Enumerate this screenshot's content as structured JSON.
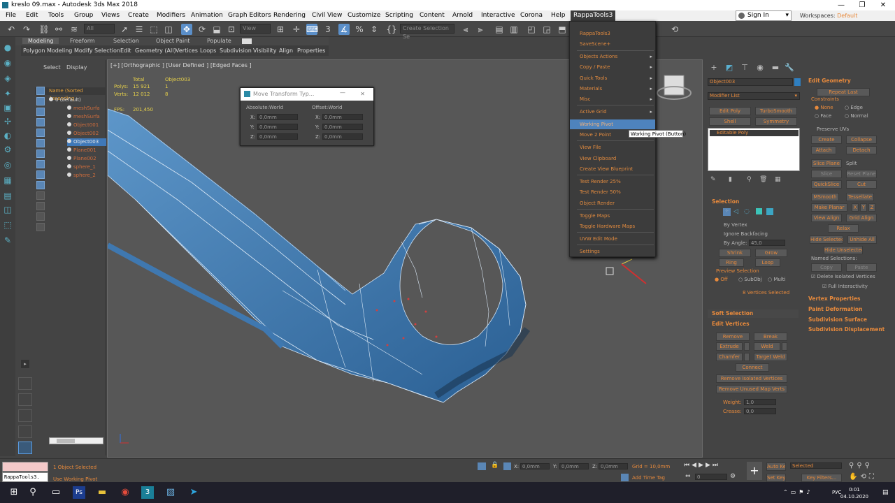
{
  "window": {
    "title": "kreslo 09.max - Autodesk 3ds Max 2018",
    "min": "—",
    "max": "❐",
    "close": "✕"
  },
  "menu": [
    "File",
    "Edit",
    "Tools",
    "Group",
    "Views",
    "Create",
    "Modifiers",
    "Animation",
    "Graph Editors",
    "Rendering",
    "Civil View",
    "Customize",
    "Scripting",
    "Content",
    "Arnold",
    "Interactive",
    "Corona",
    "Help",
    "RappaTools3"
  ],
  "signin": "Sign In",
  "workspaces": {
    "label": "Workspaces:",
    "value": "Default"
  },
  "toolbar": {
    "filter": "All",
    "view": "View",
    "selection_set": "Create Selection Se"
  },
  "ribbon": {
    "tabs": [
      "Modeling",
      "Freeform",
      "Selection",
      "Object Paint",
      "Populate"
    ],
    "sub": [
      "Polygon Modeling",
      "Modify Selection",
      "Edit",
      "Geometry (All)",
      "Vertices",
      "Loops",
      "Subdivision",
      "Visibility",
      "Align",
      "Properties"
    ]
  },
  "scene_explorer": {
    "tabs": [
      "Select",
      "Display"
    ],
    "column": "Name (Sorted Ascending",
    "objects": [
      "0 (default)",
      "meshSurfa",
      "meshSurfa",
      "Object001",
      "Object002",
      "Object003",
      "Plane001",
      "Plane002",
      "sphere_1",
      "sphere_2"
    ],
    "selected_index": 5
  },
  "viewport": {
    "label": "[+] [Orthographic ] [User Defined ] [Edged Faces ]",
    "stats": {
      "col1": "Total",
      "col2": "Object003",
      "polys_label": "Polys:",
      "polys_total": "15 921",
      "polys_obj": "1",
      "verts_label": "Verts:",
      "verts_total": "12 012",
      "verts_obj": "8",
      "fps_label": "FPS:",
      "fps": "201,450"
    }
  },
  "move_transform": {
    "title": "Move Transform Typ...",
    "abs": "Absolute:World",
    "off": "Offset:World",
    "x": "X:",
    "y": "Y:",
    "z": "Z:",
    "abs_x": "0,0mm",
    "abs_y": "0,0mm",
    "abs_z": "0,0mm",
    "off_x": "0,0mm",
    "off_y": "0,0mm",
    "off_z": "0,0mm"
  },
  "rappa_menu": {
    "items": [
      {
        "label": "RappaTools3"
      },
      {
        "label": "SaveScene+"
      },
      {
        "label": "Objects Actions",
        "sub": true
      },
      {
        "label": "Copy / Paste",
        "sub": true
      },
      {
        "label": "Quick Tools",
        "sub": true
      },
      {
        "label": "Materials",
        "sub": true
      },
      {
        "label": "Misc",
        "sub": true
      },
      {
        "label": "Active Grid",
        "sub": true
      },
      {
        "label": "Working Pivot"
      },
      {
        "label": "Move 2 Point"
      },
      {
        "label": "View File"
      },
      {
        "label": "View Clipboard"
      },
      {
        "label": "Create View Blueprint"
      },
      {
        "label": "Test Render 25%"
      },
      {
        "label": "Test Render 50%"
      },
      {
        "label": "Object Render"
      },
      {
        "label": "Toggle Maps"
      },
      {
        "label": "Toggle Hardware Maps"
      },
      {
        "label": "UVW Edit Mode"
      },
      {
        "label": "Settings"
      }
    ],
    "highlighted": "Working Pivot"
  },
  "tooltip": "Working Pivot (Button)",
  "command_panel": {
    "object_name": "Object003",
    "modifier_list": "Modifier List",
    "quick_buttons": [
      "Edit Poly",
      "TurboSmooth",
      "Shell",
      "Symmetry"
    ],
    "stack_item": "Editable Poly",
    "selection": {
      "title": "Selection",
      "by_vertex": "By Vertex",
      "ignore_backfacing": "Ignore Backfacing",
      "by_angle": "By Angle:",
      "angle": "45,0",
      "shrink": "Shrink",
      "grow": "Grow",
      "ring": "Ring",
      "loop": "Loop",
      "preview": "Preview Selection",
      "off": "Off",
      "subobj": "SubObj",
      "multi": "Multi",
      "status": "8 Vertices Selected"
    },
    "soft_selection": "Soft Selection",
    "edit_vertices": {
      "title": "Edit Vertices",
      "remove": "Remove",
      "break": "Break",
      "extrude": "Extrude",
      "weld": "Weld",
      "chamfer": "Chamfer",
      "target_weld": "Target Weld",
      "connect": "Connect",
      "remove_iso": "Remove Isolated Vertices",
      "remove_map": "Remove Unused Map Verts",
      "weight_label": "Weight:",
      "weight": "1,0",
      "crease_label": "Crease:",
      "crease": "0,0"
    },
    "edit_geometry": {
      "title": "Edit Geometry",
      "repeat": "Repeat Last",
      "constraints": "Constraints",
      "none": "None",
      "edge": "Edge",
      "face": "Face",
      "normal": "Normal",
      "preserve": "Preserve UVs",
      "create": "Create",
      "collapse": "Collapse",
      "attach": "Attach",
      "detach": "Detach",
      "slice_plane": "Slice Plane",
      "split": "Split",
      "slice": "Slice",
      "reset_plane": "Reset Plane",
      "quickslice": "QuickSlice",
      "cut": "Cut",
      "msmooth": "MSmooth",
      "tessellate": "Tessellate",
      "make_planar": "Make Planar",
      "x": "X",
      "y": "Y",
      "z": "Z",
      "view_align": "View Align",
      "grid_align": "Grid Align",
      "relax": "Relax",
      "hide_sel": "Hide Selected",
      "unhide_all": "Unhide All",
      "hide_unsel": "Hide Unselected",
      "named_sel": "Named Selections:",
      "copy": "Copy",
      "paste": "Paste",
      "delete_iso": "Delete Isolated Vertices",
      "full_inter": "Full Interactivity"
    },
    "rollouts": [
      "Vertex Properties",
      "Paint Deformation",
      "Subdivision Surface",
      "Subdivision Displacement"
    ]
  },
  "status": {
    "maxscript": "RappaTools3.",
    "selected": "1 Object Selected",
    "prompt": "Use Working Pivot",
    "x": "0,0mm",
    "y": "0,0mm",
    "z": "0,0mm",
    "grid": "Grid = 10,0mm",
    "add_time_tag": "Add Time Tag",
    "auto_key": "Auto Key",
    "selected_dd": "Selected",
    "set_key": "Set Key",
    "key_filters": "Key Filters...",
    "frame": "0"
  },
  "taskbar": {
    "time": "0:01",
    "date": "04.10.2020",
    "lang": "РУС"
  }
}
